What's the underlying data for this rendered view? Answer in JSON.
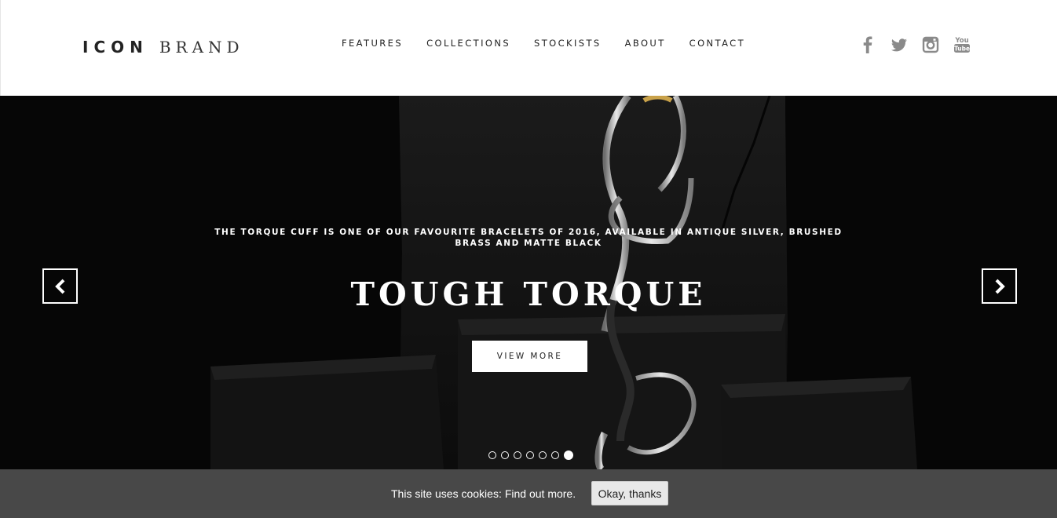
{
  "header": {
    "logo_bold": "ICON",
    "logo_light": "BRAND",
    "nav": [
      {
        "label": "FEATURES"
      },
      {
        "label": "COLLECTIONS"
      },
      {
        "label": "STOCKISTS"
      },
      {
        "label": "ABOUT"
      },
      {
        "label": "CONTACT"
      }
    ],
    "social": [
      "facebook-icon",
      "twitter-icon",
      "instagram-icon",
      "youtube-icon"
    ],
    "youtube_text_top": "You",
    "youtube_text_bottom": "Tube"
  },
  "hero": {
    "caption": "THE TORQUE CUFF IS ONE OF OUR FAVOURITE BRACELETS OF 2016, AVAILABLE IN ANTIQUE SILVER, BRUSHED BRASS AND MATTE BLACK",
    "headline": "TOUGH TORQUE",
    "button_label": "VIEW MORE",
    "slide_count": 7,
    "active_slide": 7,
    "prev_icon": "chevron-left-icon",
    "next_icon": "chevron-right-icon"
  },
  "cookie": {
    "text": "This site uses cookies:",
    "link_label": "Find out more.",
    "button_label": "Okay, thanks"
  },
  "colors": {
    "hero_background": "#080808",
    "cookie_bar": "#484848",
    "nav_text": "#222222",
    "social_icon": "#8a8a8a"
  }
}
